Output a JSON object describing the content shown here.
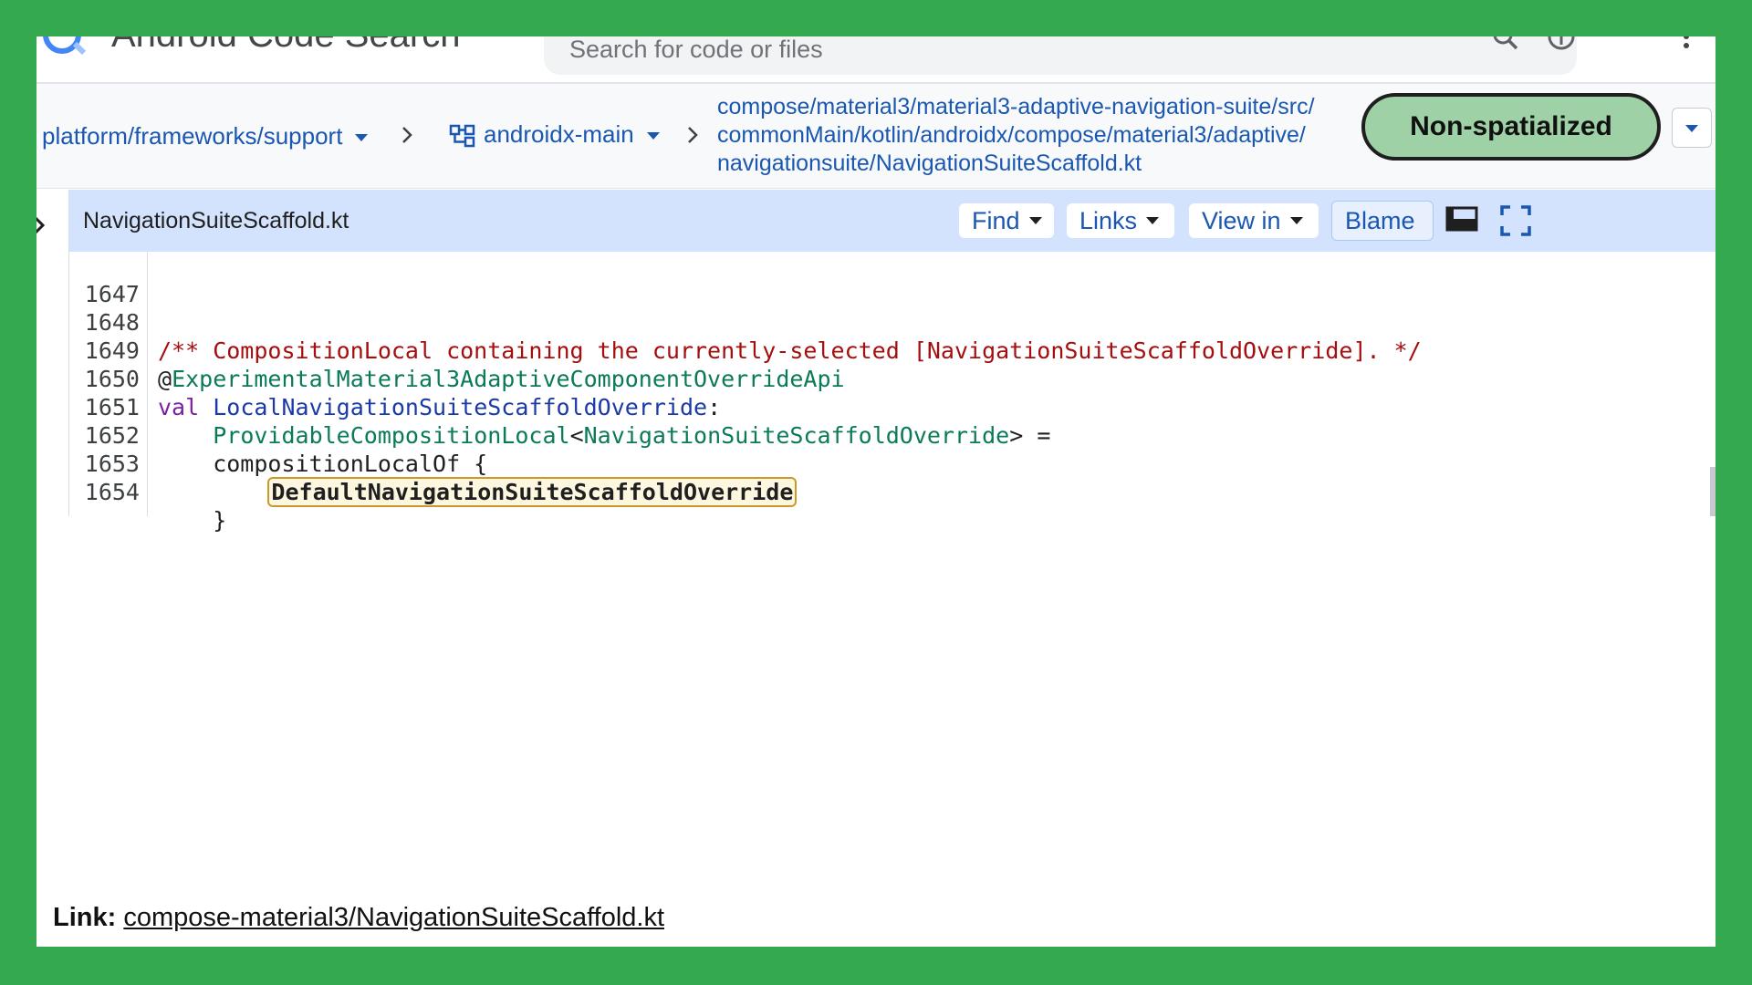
{
  "header": {
    "app_title": "Android Code Search",
    "search_placeholder": "Search for code or files"
  },
  "breadcrumb": {
    "repo": "platform/frameworks/support",
    "branch": "androidx-main",
    "path_segments": [
      "compose",
      "material3",
      "material3-adaptive-navigation-suite",
      "src",
      "commonMain",
      "kotlin",
      "androidx",
      "compose",
      "material3",
      "adaptive",
      "navigationsuite",
      "NavigationSuiteScaffold.kt"
    ]
  },
  "badge": {
    "label": "Non-spatialized",
    "color": "#9fd1a7"
  },
  "file_bar": {
    "file_name": "NavigationSuiteScaffold.kt",
    "find_label": "Find",
    "links_label": "Links",
    "view_in_label": "View in",
    "blame_label": "Blame"
  },
  "code": {
    "lines": [
      {
        "num": "1647",
        "text": ""
      },
      {
        "num": "1648",
        "text": "/** CompositionLocal containing the currently-selected [NavigationSuiteScaffoldOverride]. */"
      },
      {
        "num": "1649",
        "at": "@",
        "text": "ExperimentalMaterial3AdaptiveComponentOverrideApi"
      },
      {
        "num": "1650",
        "kw": "val ",
        "decl": "LocalNavigationSuiteScaffoldOverride",
        "tail": ":"
      },
      {
        "num": "1651",
        "indent": "    ",
        "type1": "ProvidableCompositionLocal",
        "lt": "<",
        "type2": "NavigationSuiteScaffoldOverride",
        "tail": "> ="
      },
      {
        "num": "1652",
        "text": "    compositionLocalOf {"
      },
      {
        "num": "1653",
        "indent": "        ",
        "highlight": "DefaultNavigationSuiteScaffoldOverride"
      },
      {
        "num": "1654",
        "text": "    }"
      }
    ]
  },
  "footer": {
    "label": "Link:",
    "link_text": "compose-material3/NavigationSuiteScaffold.kt"
  },
  "colors": {
    "frame": "#35a94f",
    "link": "#1a57b0",
    "file_bar": "#d3e3fd",
    "comment": "#a50e0e",
    "keyword": "#7b1fa2",
    "type": "#0b7a5a"
  }
}
